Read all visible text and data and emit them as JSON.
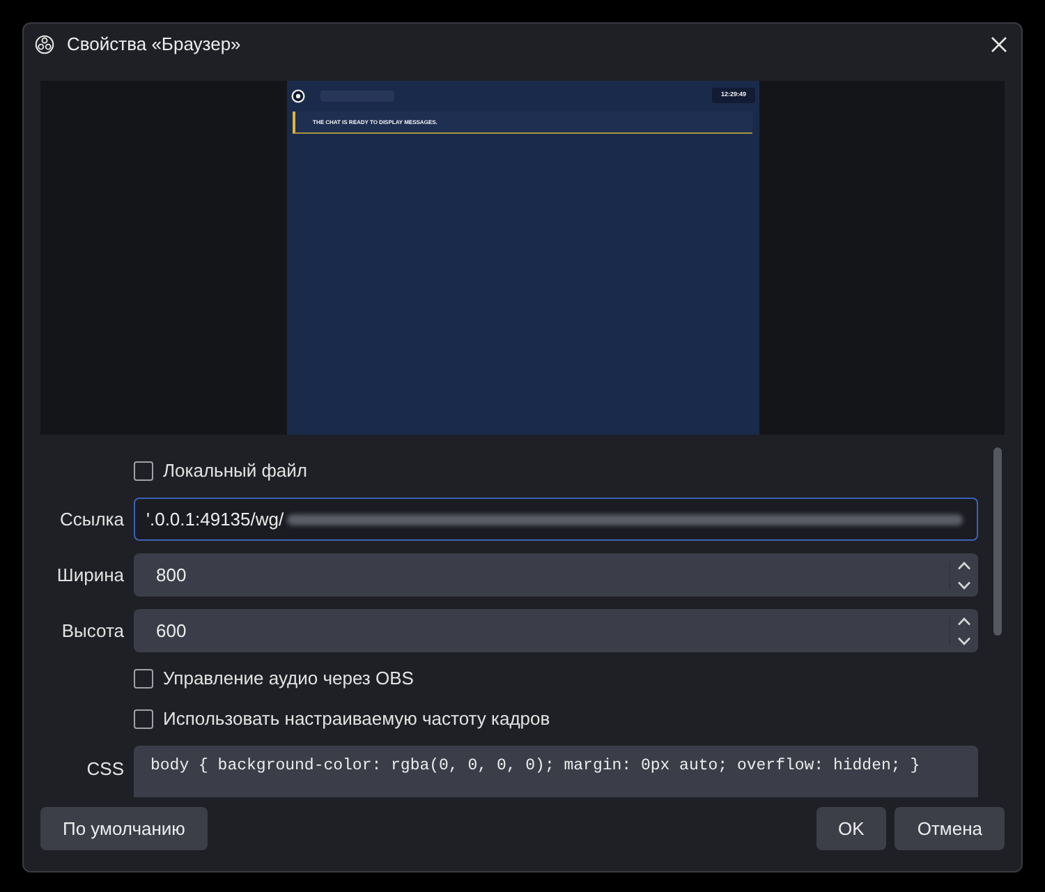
{
  "window": {
    "title": "Свойства «Браузер»"
  },
  "preview": {
    "clock": "12:29:49",
    "message": "THE CHAT IS READY TO DISPLAY MESSAGES."
  },
  "form": {
    "rows": [
      {
        "kind": "checkbox",
        "label": "Локальный файл",
        "checked": false
      },
      {
        "kind": "text",
        "label": "Ссылка",
        "value": "'.0.0.1:49135/wg/",
        "focused": true,
        "redacted": true
      },
      {
        "kind": "spin",
        "label": "Ширина",
        "value": "800"
      },
      {
        "kind": "spin",
        "label": "Высота",
        "value": "600"
      },
      {
        "kind": "checkbox",
        "label": "Управление аудио через OBS",
        "checked": false
      },
      {
        "kind": "checkbox",
        "label": "Использовать настраиваемую частоту кадров",
        "checked": false
      },
      {
        "kind": "code",
        "label": "CSS",
        "value": "body { background-color: rgba(0, 0, 0, 0); margin: 0px auto; overflow: hidden; }"
      }
    ]
  },
  "footer": {
    "left": [
      {
        "label": "По умолчанию"
      }
    ],
    "right": [
      {
        "label": "OK"
      },
      {
        "label": "Отмена"
      }
    ]
  }
}
